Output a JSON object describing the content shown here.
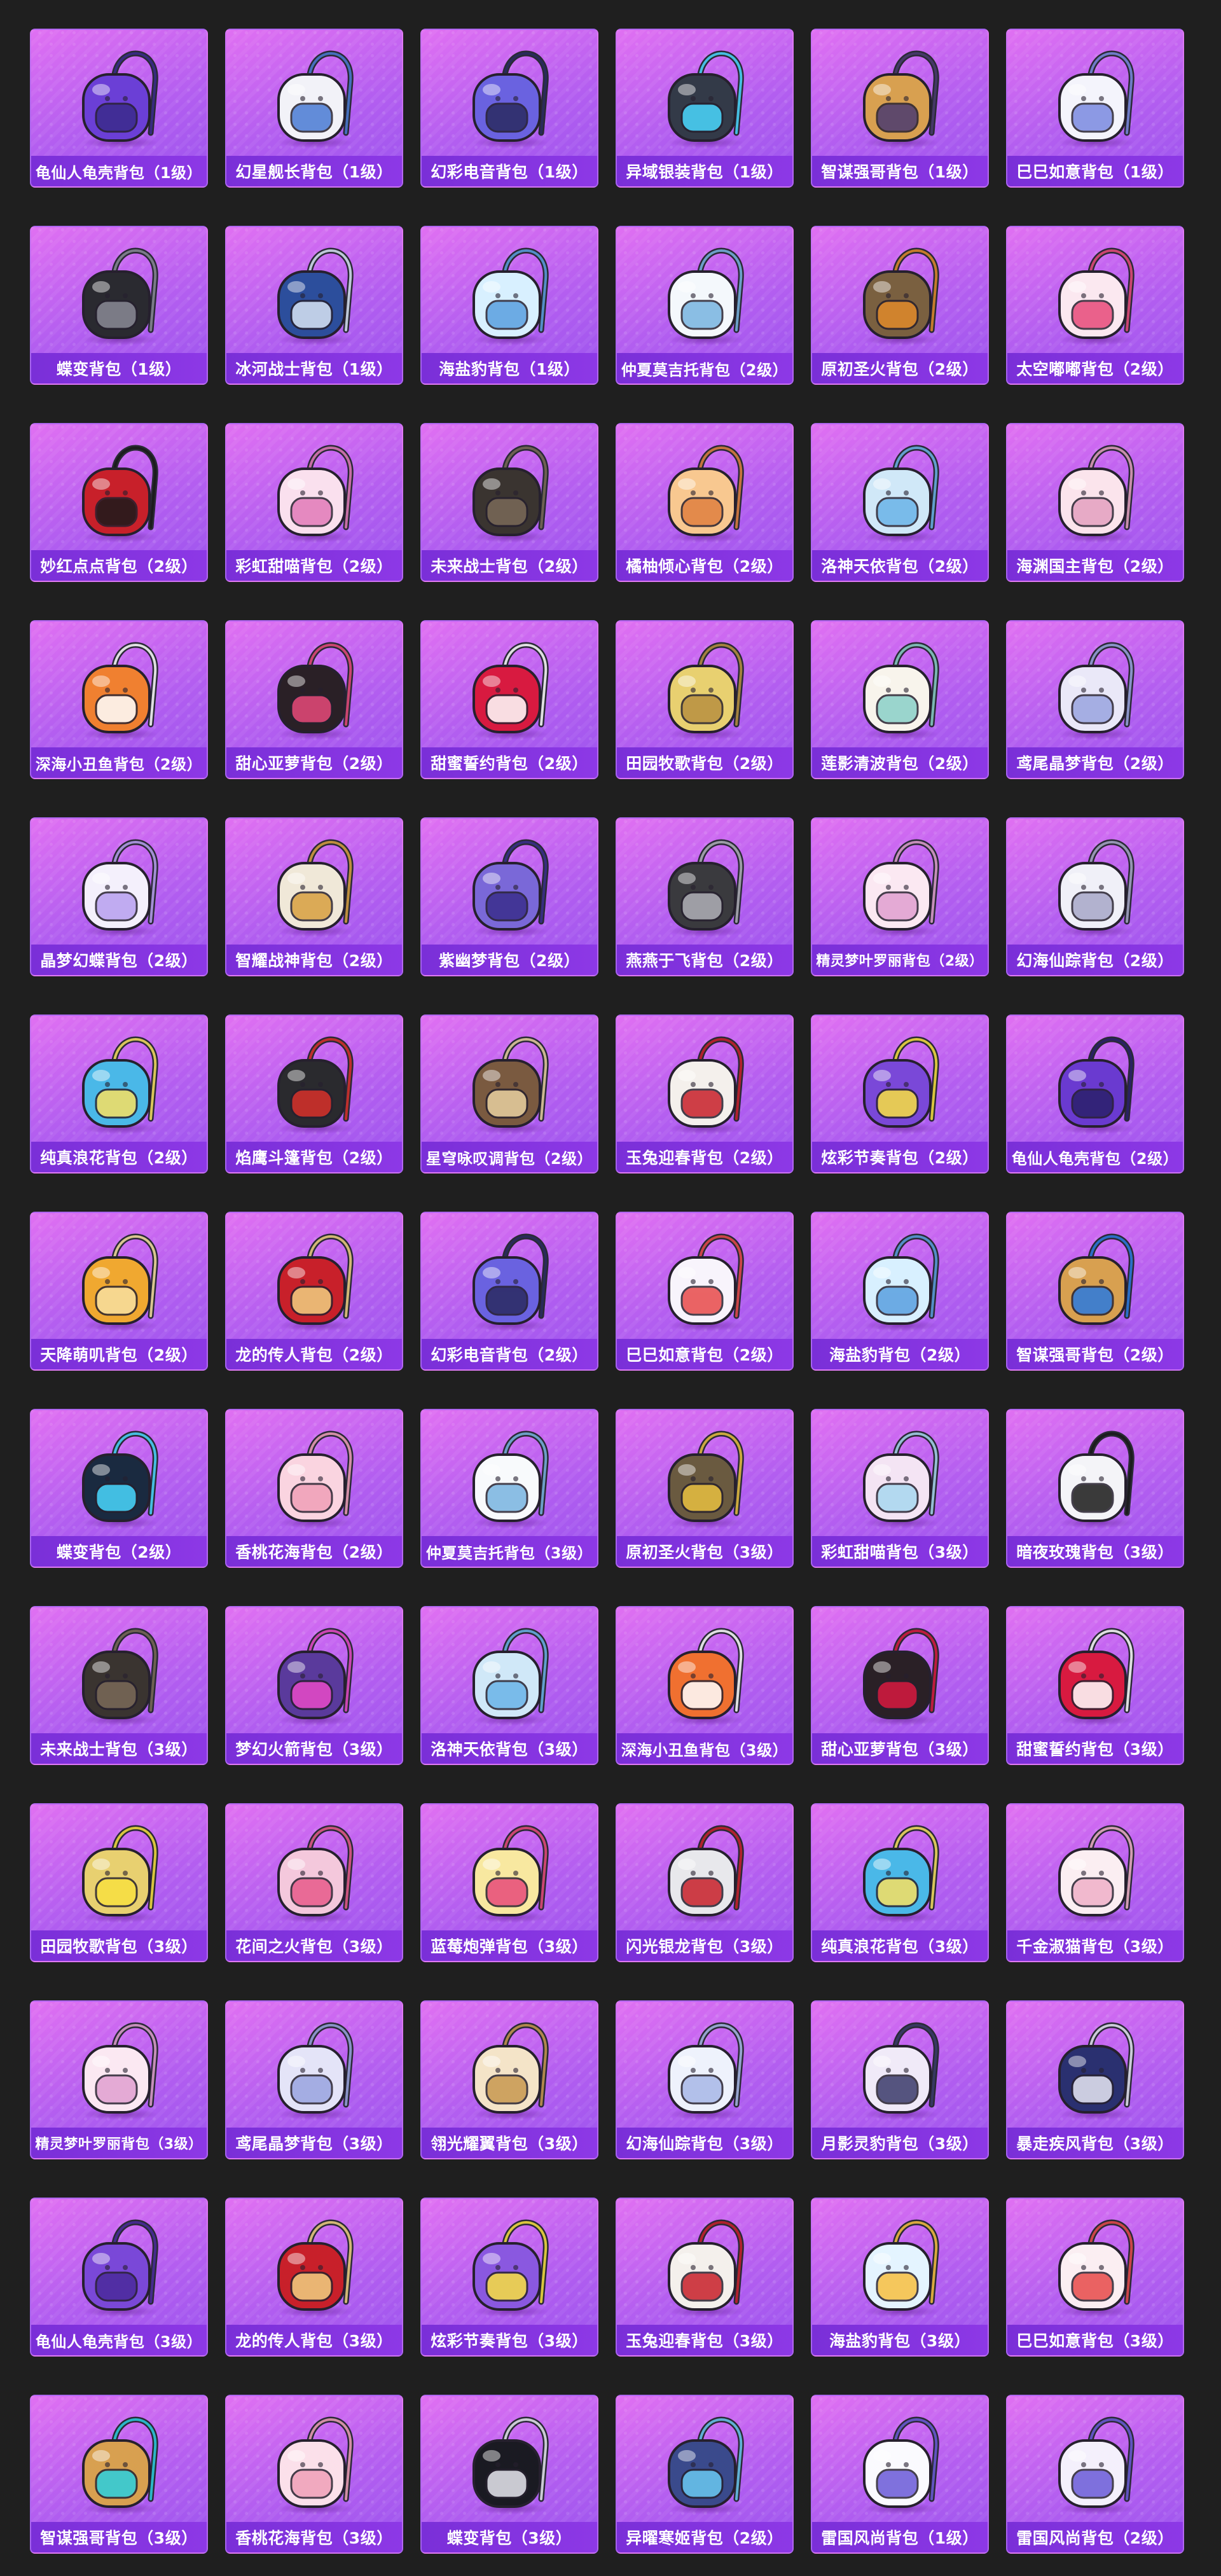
{
  "items": [
    {
      "name": "龟仙人龟壳背包（1级）",
      "color": "#6b3fd6",
      "accent": "#3a2a8c"
    },
    {
      "name": "幻星舰长背包（1级）",
      "color": "#f2f2f8",
      "accent": "#4a7bd4"
    },
    {
      "name": "幻彩电音背包（1级）",
      "color": "#6a62e0",
      "accent": "#2a2a60"
    },
    {
      "name": "异域银装背包（1级）",
      "color": "#333a48",
      "accent": "#4ad8ff"
    },
    {
      "name": "智谋强哥背包（1级）",
      "color": "#d8a050",
      "accent": "#4a3a70"
    },
    {
      "name": "巳巳如意背包（1级）",
      "color": "#f4f4fc",
      "accent": "#7a8ae0"
    },
    {
      "name": "蝶变背包（1级）",
      "color": "#2a2a30",
      "accent": "#8a8a96"
    },
    {
      "name": "冰河战士背包（1级）",
      "color": "#2c4e9c",
      "accent": "#d8e4f4"
    },
    {
      "name": "海盐豹背包（1级）",
      "color": "#d8f0ff",
      "accent": "#5aa0e0"
    },
    {
      "name": "仲夏莫吉托背包（2级）",
      "color": "#f4f8fc",
      "accent": "#78b4e0"
    },
    {
      "name": "原初圣火背包（2级）",
      "color": "#7a6040",
      "accent": "#e08a2a"
    },
    {
      "name": "太空嘟嘟背包（2级）",
      "color": "#fbe8f0",
      "accent": "#e84a7a"
    },
    {
      "name": "妙红点点背包（2级）",
      "color": "#c8202a",
      "accent": "#1a1a1a"
    },
    {
      "name": "彩虹甜喵背包（2级）",
      "color": "#fae0ee",
      "accent": "#e27ab8"
    },
    {
      "name": "未来战士背包（2级）",
      "color": "#3a3430",
      "accent": "#7a6a58"
    },
    {
      "name": "橘柚倾心背包（2级）",
      "color": "#f8c890",
      "accent": "#e08040"
    },
    {
      "name": "洛神天依背包（2级）",
      "color": "#d0e8f8",
      "accent": "#6ab4e8"
    },
    {
      "name": "海渊国主背包（2级）",
      "color": "#fbe4ec",
      "accent": "#e4a0c0"
    },
    {
      "name": "深海小丑鱼背包（2级）",
      "color": "#f08030",
      "accent": "#ffffff"
    },
    {
      "name": "甜心亚萝背包（2级）",
      "color": "#2a2026",
      "accent": "#e84a7a"
    },
    {
      "name": "甜蜜誓约背包（2级）",
      "color": "#d81a40",
      "accent": "#ffffff"
    },
    {
      "name": "田园牧歌背包（2级）",
      "color": "#e8d070",
      "accent": "#b89040"
    },
    {
      "name": "莲影清波背包（2级）",
      "color": "#f8f4ec",
      "accent": "#8ad0c8"
    },
    {
      "name": "鸢尾晶梦背包（2级）",
      "color": "#eae8f8",
      "accent": "#9aa4e0"
    },
    {
      "name": "晶梦幻蝶背包（2级）",
      "color": "#f4f0fc",
      "accent": "#b8a0f0"
    },
    {
      "name": "智耀战神背包（2级）",
      "color": "#f0e8d8",
      "accent": "#d8a040"
    },
    {
      "name": "紫幽梦背包（2级）",
      "color": "#7a68d8",
      "accent": "#3a2e8c"
    },
    {
      "name": "燕燕于飞背包（2级）",
      "color": "#3a3a3e",
      "accent": "#b0b0b8"
    },
    {
      "name": "精灵梦叶罗丽背包（2级）",
      "color": "#fbe8f2",
      "accent": "#e0a0d0"
    },
    {
      "name": "幻海仙踪背包（2级）",
      "color": "#f0f0f8",
      "accent": "#a8a8c8"
    },
    {
      "name": "纯真浪花背包（2级）",
      "color": "#4ab8e8",
      "accent": "#f8e060"
    },
    {
      "name": "焰鹰斗篷背包（2级）",
      "color": "#2a2a2e",
      "accent": "#d8302a"
    },
    {
      "name": "星穹咏叹调背包（2级）",
      "color": "#7a5a40",
      "accent": "#e8d0a0"
    },
    {
      "name": "玉兔迎春背包（2级）",
      "color": "#f4f0ec",
      "accent": "#c8202a"
    },
    {
      "name": "炫彩节奏背包（2级）",
      "color": "#7a48d8",
      "accent": "#f8e040"
    },
    {
      "name": "龟仙人龟壳背包（2级）",
      "color": "#6a3ad0",
      "accent": "#2a206a"
    },
    {
      "name": "天降萌叽背包（2级）",
      "color": "#f0a830",
      "accent": "#f8e0a0"
    },
    {
      "name": "龙的传人背包（2级）",
      "color": "#c8202a",
      "accent": "#f0d080"
    },
    {
      "name": "幻彩电音背包（2级）",
      "color": "#6a62e0",
      "accent": "#2a2a60"
    },
    {
      "name": "巳巳如意背包（2级）",
      "color": "#f8f4fc",
      "accent": "#e84a4a"
    },
    {
      "name": "海盐豹背包（2级）",
      "color": "#d8f0ff",
      "accent": "#5aa0e0"
    },
    {
      "name": "智谋强哥背包（2级）",
      "color": "#d8a050",
      "accent": "#2a7ae0"
    },
    {
      "name": "蝶变背包（2级）",
      "color": "#1a2a40",
      "accent": "#4ad8ff"
    },
    {
      "name": "香桃花海背包（2级）",
      "color": "#fad4e0",
      "accent": "#f0a0b8"
    },
    {
      "name": "仲夏莫吉托背包（3级）",
      "color": "#f8fafc",
      "accent": "#78b4e0"
    },
    {
      "name": "原初圣火背包（3级）",
      "color": "#6a5a40",
      "accent": "#e8c040"
    },
    {
      "name": "彩虹甜喵背包（3级）",
      "color": "#f4e4f4",
      "accent": "#a8d8f0"
    },
    {
      "name": "暗夜玫瑰背包（3级）",
      "color": "#f4f4f8",
      "accent": "#1a1a1a"
    },
    {
      "name": "未来战士背包（3级）",
      "color": "#3a3430",
      "accent": "#7a6a58"
    },
    {
      "name": "梦幻火箭背包（3级）",
      "color": "#5a3a9c",
      "accent": "#e84ac8"
    },
    {
      "name": "洛神天依背包（3级）",
      "color": "#d0e8f8",
      "accent": "#6ab4e8"
    },
    {
      "name": "深海小丑鱼背包（3级）",
      "color": "#f07030",
      "accent": "#ffffff"
    },
    {
      "name": "甜心亚萝背包（3级）",
      "color": "#2a2026",
      "accent": "#d81a40"
    },
    {
      "name": "甜蜜誓约背包（3级）",
      "color": "#d81a40",
      "accent": "#ffffff"
    },
    {
      "name": "田园牧歌背包（3级）",
      "color": "#e8d070",
      "accent": "#f8e040"
    },
    {
      "name": "花间之火背包（3级）",
      "color": "#f4c8dc",
      "accent": "#e85a8a"
    },
    {
      "name": "蓝莓炮弹背包（3级）",
      "color": "#f8e8a0",
      "accent": "#e84a7a"
    },
    {
      "name": "闪光银龙背包（3级）",
      "color": "#e8e8ec",
      "accent": "#c8202a"
    },
    {
      "name": "纯真浪花背包（3级）",
      "color": "#4ab8e8",
      "accent": "#f8e060"
    },
    {
      "name": "千金淑猫背包（3级）",
      "color": "#fbeef2",
      "accent": "#f0b0c8"
    },
    {
      "name": "精灵梦叶罗丽背包（3级）",
      "color": "#fbe8f2",
      "accent": "#e0a0d0"
    },
    {
      "name": "鸢尾晶梦背包（3级）",
      "color": "#e4e4f8",
      "accent": "#9aa4e0"
    },
    {
      "name": "翎光耀翼背包（3级）",
      "color": "#f4e4c8",
      "accent": "#c89850"
    },
    {
      "name": "幻海仙踪背包（3级）",
      "color": "#eef2fc",
      "accent": "#a8b8e8"
    },
    {
      "name": "月影灵豹背包（3级）",
      "color": "#f0eaf8",
      "accent": "#3a3a6a"
    },
    {
      "name": "暴走疾风背包（3级）",
      "color": "#2a3070",
      "accent": "#e8e8f4"
    },
    {
      "name": "龟仙人龟壳背包（3级）",
      "color": "#7a48d8",
      "accent": "#4a2a9c"
    },
    {
      "name": "龙的传人背包（3级）",
      "color": "#c8202a",
      "accent": "#f0d080"
    },
    {
      "name": "炫彩节奏背包（3级）",
      "color": "#8a58e0",
      "accent": "#f8e040"
    },
    {
      "name": "玉兔迎春背包（3级）",
      "color": "#f4f0ec",
      "accent": "#c8202a"
    },
    {
      "name": "海盐豹背包（3级）",
      "color": "#e4f4ff",
      "accent": "#f8c040"
    },
    {
      "name": "巳巳如意背包（3级）",
      "color": "#fbeef2",
      "accent": "#e84a4a"
    },
    {
      "name": "智谋强哥背包（3级）",
      "color": "#d8a050",
      "accent": "#2ad0e0"
    },
    {
      "name": "香桃花海背包（3级）",
      "color": "#fbe0ea",
      "accent": "#f0a0b8"
    },
    {
      "name": "蝶变背包（3级）",
      "color": "#1a1a22",
      "accent": "#e8e8f0"
    },
    {
      "name": "异曜寒姬背包（2级）",
      "color": "#3a4a8c",
      "accent": "#6ac8f0"
    },
    {
      "name": "雷国风尚背包（1级）",
      "color": "#fafafe",
      "accent": "#6a5ad8"
    },
    {
      "name": "雷国风尚背包（2级）",
      "color": "#f4f0fc",
      "accent": "#6a5ad8"
    }
  ]
}
